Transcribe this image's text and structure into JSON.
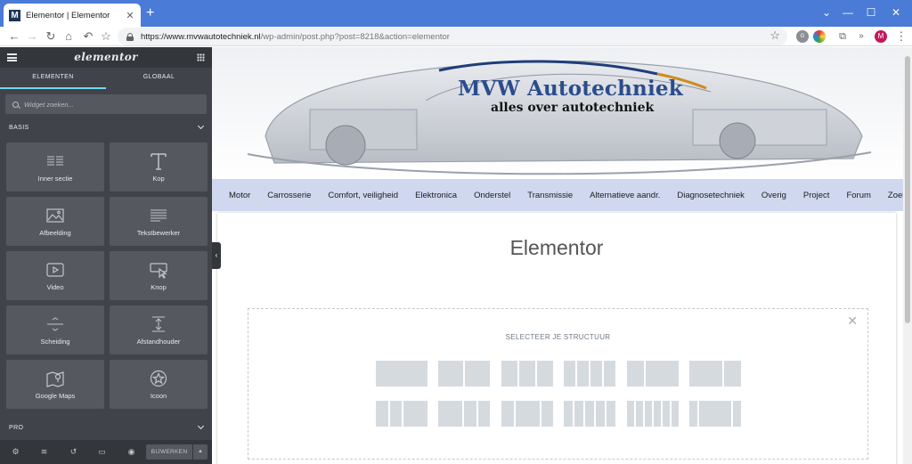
{
  "browser": {
    "tab_title": "Elementor | Elementor",
    "favicon_letter": "M",
    "url_host": "https://www.mvwautotechniek.nl",
    "url_path": "/wp-admin/post.php?post=8218&action=elementor",
    "profile_initial": "M"
  },
  "panel": {
    "logo": "elementor",
    "tabs": [
      {
        "label": "ELEMENTEN",
        "active": true
      },
      {
        "label": "GLOBAAL",
        "active": false
      }
    ],
    "search_placeholder": "Widget zoeken...",
    "category_basis": "BASIS",
    "category_pro": "PRO",
    "widgets": [
      {
        "label": "Inner sectie",
        "icon": "inner-section-icon"
      },
      {
        "label": "Kop",
        "icon": "heading-icon"
      },
      {
        "label": "Afbeelding",
        "icon": "image-icon"
      },
      {
        "label": "Tekstbewerker",
        "icon": "text-editor-icon"
      },
      {
        "label": "Video",
        "icon": "video-icon"
      },
      {
        "label": "Knop",
        "icon": "button-icon"
      },
      {
        "label": "Scheiding",
        "icon": "divider-icon"
      },
      {
        "label": "Afstandhouder",
        "icon": "spacer-icon"
      },
      {
        "label": "Google Maps",
        "icon": "map-icon"
      },
      {
        "label": "Icoon",
        "icon": "star-icon"
      }
    ],
    "update_button": "BIJWERKEN"
  },
  "site": {
    "title": "MVW Autotechniek",
    "tagline": "alles over autotechniek",
    "nav": [
      "Motor",
      "Carrosserie",
      "Comfort, veiligheid",
      "Elektronica",
      "Onderstel",
      "Transmissie",
      "Alternatieve aandr.",
      "Diagnosetechniek",
      "Overig",
      "Project",
      "Forum",
      "Zoek"
    ]
  },
  "editor": {
    "page_title": "Elementor",
    "structure_title": "SELECTEER JE STRUCTUUR"
  },
  "colors": {
    "browser_accent": "#4a7bd6",
    "panel_bg": "#404349",
    "tab_active_underline": "#71d7f7",
    "nav_bg": "#cfd8ef",
    "title_blue": "#2b4c8c"
  }
}
